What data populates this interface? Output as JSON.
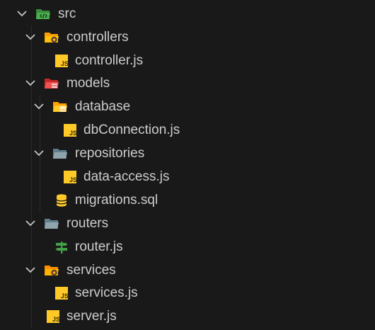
{
  "explorer": {
    "items": [
      {
        "label": "src",
        "kind": "folder",
        "icon": "folder-src-open-icon"
      },
      {
        "label": "controllers",
        "kind": "folder",
        "icon": "folder-controllers-open-icon"
      },
      {
        "label": "controller.js",
        "kind": "file",
        "icon": "javascript-file-icon"
      },
      {
        "label": "models",
        "kind": "folder",
        "icon": "folder-models-open-icon"
      },
      {
        "label": "database",
        "kind": "folder",
        "icon": "folder-database-open-icon"
      },
      {
        "label": "dbConnection.js",
        "kind": "file",
        "icon": "javascript-file-icon"
      },
      {
        "label": "repositories",
        "kind": "folder",
        "icon": "folder-open-icon"
      },
      {
        "label": "data-access.js",
        "kind": "file",
        "icon": "javascript-file-icon"
      },
      {
        "label": "migrations.sql",
        "kind": "file",
        "icon": "database-file-icon"
      },
      {
        "label": "routers",
        "kind": "folder",
        "icon": "folder-open-icon"
      },
      {
        "label": "router.js",
        "kind": "file",
        "icon": "router-file-icon"
      },
      {
        "label": "services",
        "kind": "folder",
        "icon": "folder-services-open-icon"
      },
      {
        "label": "services.js",
        "kind": "file",
        "icon": "javascript-file-icon"
      },
      {
        "label": "server.js",
        "kind": "file",
        "icon": "javascript-file-icon"
      }
    ]
  },
  "colors": {
    "background": "#191919",
    "text": "#cccccc",
    "chevron": "#c5c5c5",
    "folder_src": "#4caf50",
    "folder_controllers": "#ffc107",
    "folder_models": "#ef5350",
    "folder_database": "#ffca28",
    "folder_generic": "#90a4ae",
    "folder_services": "#ffb300",
    "js_icon": "#ffca28",
    "sql_icon": "#ffca28",
    "router_icon": "#43a047"
  }
}
